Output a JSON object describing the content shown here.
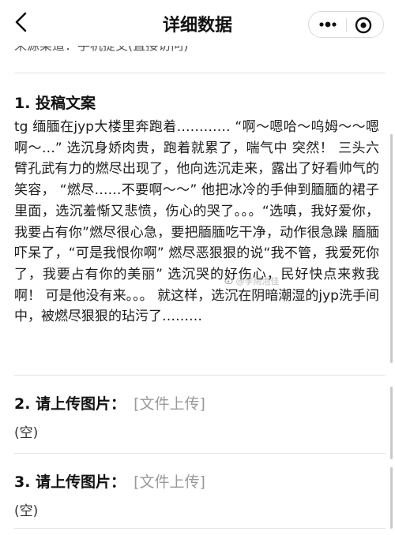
{
  "navbar": {
    "title": "详细数据"
  },
  "source": {
    "text": "来源渠道：手机提交(直接访问)"
  },
  "question1": {
    "title": "1. 投稿文案",
    "content": "tg 缅腼在jyp大楼里奔跑着………… “啊～嗯哈～呜姆～～嗯啊～…” 选沉身娇肉贵，跑着就累了，喘气中 突然！ 三头六臂孔武有力的燃尽出现了，他向选沉走来，露出了好看帅气的笑容， “燃尽……不要啊～～” 他把冰冷的手伸到腼腼的裙子里面，选沉羞惭又悲愤，伤心的哭了。。。“选嗔，我好爱你，我要占有你”燃尽很心急，要把腼腼吃干净，动作很急躁 腼腼吓呆了，“可是我恨你啊” 燃尽恶狠狠的说“我不管，我爱死你了，我要占有你的美丽” 选沉哭的好伤心，民好快点来救我啊！ 可是他没有来。。。 就这样，选沉在阴暗潮湿的jyp洗手间中，被燃尽狠狠的玷污了………"
  },
  "question2": {
    "label": "2. 请上传图片：",
    "link": "[文件上传]",
    "empty": "(空)"
  },
  "question3": {
    "label": "3. 请上传图片：",
    "link": "[文件上传]",
    "empty": "(空)"
  },
  "watermark": {
    "text": "@李雨泡佳"
  }
}
